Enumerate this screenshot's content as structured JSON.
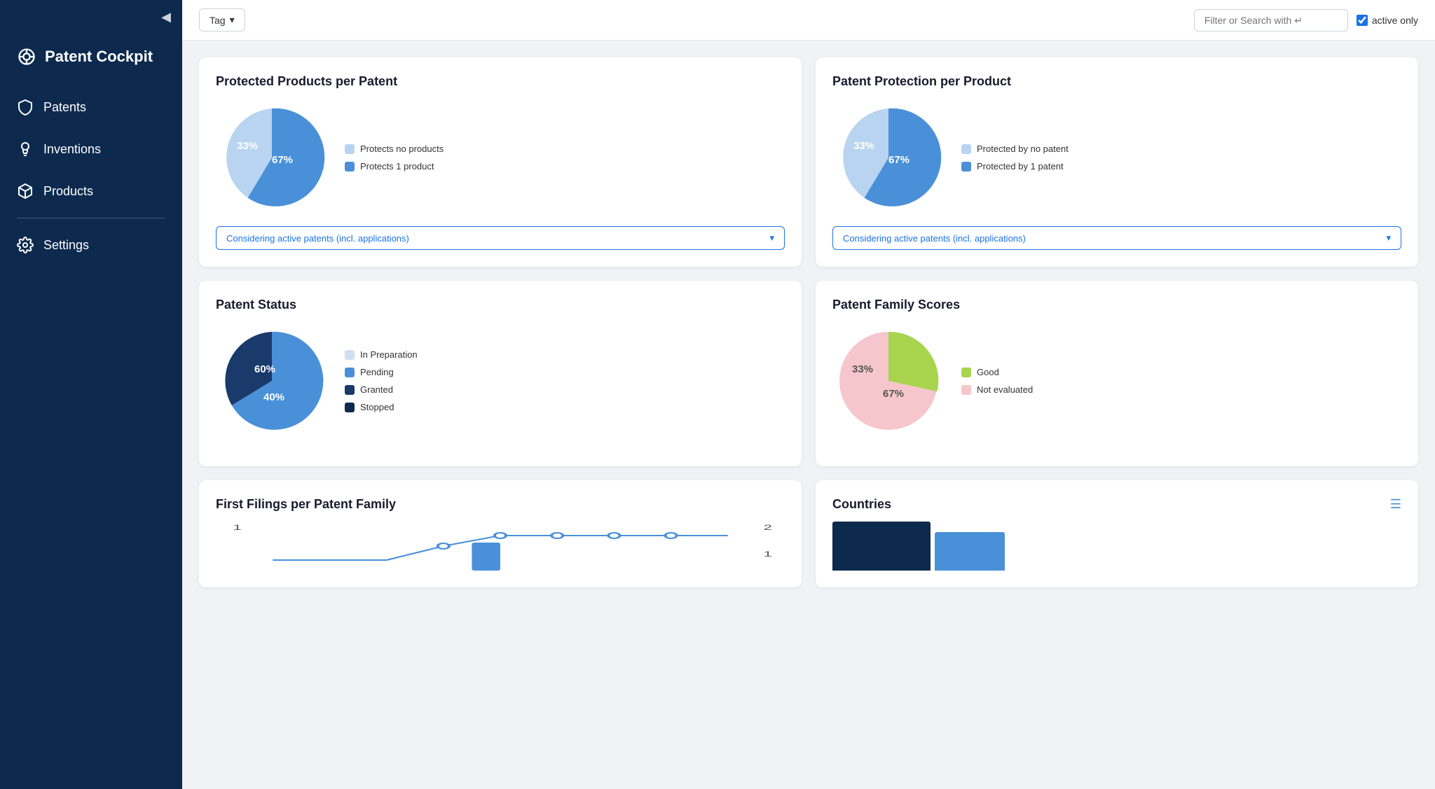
{
  "sidebar": {
    "toggle_icon": "◀",
    "brand_label": "Patent Cockpit",
    "nav_items": [
      {
        "id": "patents",
        "label": "Patents",
        "active": false
      },
      {
        "id": "inventions",
        "label": "Inventions",
        "active": false
      },
      {
        "id": "products",
        "label": "Products",
        "active": false
      },
      {
        "id": "settings",
        "label": "Settings",
        "active": false
      }
    ]
  },
  "topbar": {
    "tag_label": "Tag",
    "search_placeholder": "Filter or Search with ↵",
    "active_only_label": "active only"
  },
  "cards": [
    {
      "id": "protected-products-per-patent",
      "title": "Protected Products per Patent",
      "pie": {
        "slices": [
          {
            "label": "Protects no products",
            "percent": 33,
            "color": "#b8d4f0"
          },
          {
            "label": "Protects 1 product",
            "percent": 67,
            "color": "#4a90d9"
          }
        ]
      },
      "dropdown_label": "Considering active patents (incl. applications)"
    },
    {
      "id": "patent-protection-per-product",
      "title": "Patent Protection per Product",
      "pie": {
        "slices": [
          {
            "label": "Protected by no patent",
            "percent": 33,
            "color": "#b8d4f0"
          },
          {
            "label": "Protected by 1 patent",
            "percent": 67,
            "color": "#4a90d9"
          }
        ]
      },
      "dropdown_label": "Considering active patents (incl. applications)"
    },
    {
      "id": "patent-status",
      "title": "Patent Status",
      "pie": {
        "slices": [
          {
            "label": "In Preparation",
            "percent": 0,
            "color": "#d0dff0"
          },
          {
            "label": "Pending",
            "percent": 60,
            "color": "#4a90d9"
          },
          {
            "label": "Granted",
            "percent": 40,
            "color": "#1a3a6b"
          },
          {
            "label": "Stopped",
            "percent": 0,
            "color": "#0d2a4e"
          }
        ]
      }
    },
    {
      "id": "patent-family-scores",
      "title": "Patent Family Scores",
      "pie": {
        "slices": [
          {
            "label": "Good",
            "percent": 33,
            "color": "#a8d44e"
          },
          {
            "label": "Not evaluated",
            "percent": 67,
            "color": "#f5c6cc"
          }
        ]
      }
    }
  ],
  "bottom_cards": [
    {
      "id": "first-filings",
      "title": "First Filings per Patent Family"
    },
    {
      "id": "countries",
      "title": "Countries",
      "bars": [
        {
          "color": "#0d2a4e",
          "height": 70
        },
        {
          "color": "#4a90d9",
          "height": 55
        }
      ]
    }
  ]
}
